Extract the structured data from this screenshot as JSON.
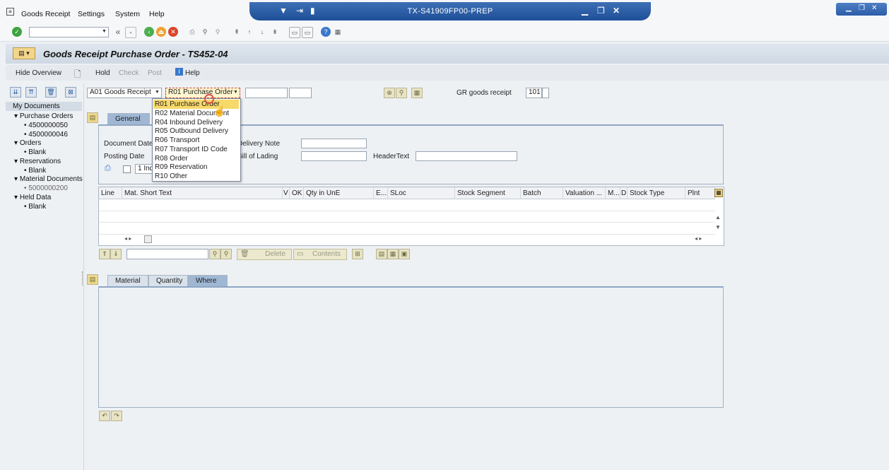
{
  "menu": {
    "items": [
      "Goods Receipt",
      "Settings",
      "System",
      "Help"
    ]
  },
  "window": {
    "system_title": "TX-S41909FP00-PREP"
  },
  "page": {
    "title": "Goods Receipt Purchase Order - TS452-04"
  },
  "app_toolbar": {
    "hide_overview": "Hide Overview",
    "hold": "Hold",
    "check": "Check",
    "post": "Post",
    "help": "Help"
  },
  "tree": {
    "root": "My Documents",
    "purchase_orders": "Purchase Orders",
    "po_1": "4500000050",
    "po_2": "4500000046",
    "orders": "Orders",
    "orders_blank": "Blank",
    "reservations": "Reservations",
    "reservations_blank": "Blank",
    "material_documents": "Material Documents",
    "matdoc_1": "5000000200",
    "held_data": "Held Data",
    "held_blank": "Blank"
  },
  "header": {
    "action_value": "A01 Goods Receipt",
    "refdoc_value": "R01 Purchase Order",
    "gr_label": "GR goods receipt",
    "movement_type": "101"
  },
  "dropdown": {
    "options": [
      "R01 Purchase Order",
      "R02 Material Document",
      "R04 Inbound Delivery",
      "R05 Outbound Delivery",
      "R06 Transport",
      "R07 Transport ID Code",
      "R08 Order",
      "R09 Reservation",
      "R10 Other"
    ],
    "selected_index": 0
  },
  "general": {
    "tab_label": "General",
    "document_date": "Document Date",
    "posting_date": "Posting Date",
    "delivery_note": "Delivery Note",
    "bill_of_lading": "Bill of Lading",
    "header_text": "HeaderText",
    "print_value": "1 Ind"
  },
  "grid": {
    "columns": [
      "Line",
      "Mat. Short Text",
      "V",
      "OK",
      "Qty in UnE",
      "E...",
      "SLoc",
      "Stock Segment",
      "Batch",
      "Valuation ...",
      "M...",
      "D",
      "Stock Type",
      "Plnt"
    ]
  },
  "grid_toolbar": {
    "delete": "Delete",
    "contents": "Contents"
  },
  "detail_tabs": [
    "Material",
    "Quantity",
    "Where"
  ],
  "colors": {
    "selected_option": "#f7d96a",
    "banner": "#1e4f98"
  }
}
